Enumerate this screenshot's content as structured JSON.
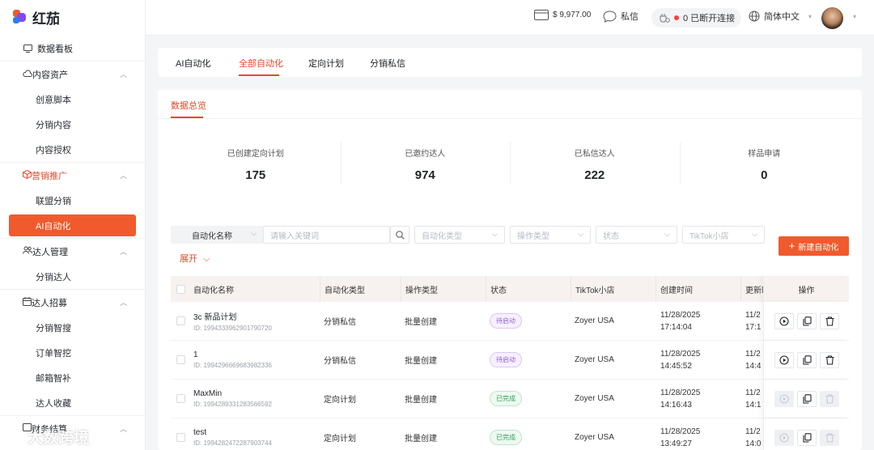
{
  "app": {
    "name": "红茄"
  },
  "sidebar": {
    "dashboard": "数据看板",
    "groups": [
      {
        "label": "内容资产",
        "items": [
          "创意脚本",
          "分销内容",
          "内容授权"
        ]
      },
      {
        "label": "营销推广",
        "items": [
          "联盟分销",
          "AI自动化"
        ]
      },
      {
        "label": "达人管理",
        "items": [
          "分销达人"
        ]
      },
      {
        "label": "达人招募",
        "items": [
          "分销智搜",
          "订单智挖",
          "邮箱智补",
          "达人收藏"
        ]
      },
      {
        "label": "财务结算",
        "items": []
      }
    ]
  },
  "header": {
    "balance": "$ 9,977.00",
    "messages": "私信",
    "connection": "0 已断开连接",
    "language": "简体中文"
  },
  "tabs": [
    "AI自动化",
    "全部自动化",
    "定向计划",
    "分销私信"
  ],
  "subtab": "数据总览",
  "stats": [
    {
      "label": "已创建定向计划",
      "value": "175"
    },
    {
      "label": "已邀约达人",
      "value": "974"
    },
    {
      "label": "已私信达人",
      "value": "222"
    },
    {
      "label": "样品申请",
      "value": "0"
    }
  ],
  "filters": {
    "field": "自动化名称",
    "keyword_placeholder": "请输入关键词",
    "type": "自动化类型",
    "op_type": "操作类型",
    "status": "状态",
    "shop": "TikTok小店",
    "expand": "展开",
    "new_button": "新建自动化"
  },
  "table": {
    "headers": [
      "自动化名称",
      "自动化类型",
      "操作类型",
      "状态",
      "TikTok小店",
      "创建时间",
      "更新时",
      "操作"
    ],
    "rows": [
      {
        "name": "3c 新品计划",
        "id": "ID: 1994333962901790720",
        "type": "分销私信",
        "op": "批量创建",
        "status": "待启动",
        "shop": "Zoyer USA",
        "date": "11/28/2025",
        "time": "17:14:04",
        "upd_date": "11/2",
        "upd_time": "17:1"
      },
      {
        "name": "1",
        "id": "ID: 1994296669683982336",
        "type": "分销私信",
        "op": "批量创建",
        "status": "待启动",
        "shop": "Zoyer USA",
        "date": "11/28/2025",
        "time": "14:45:52",
        "upd_date": "11/2",
        "upd_time": "14:4"
      },
      {
        "name": "MaxMin",
        "id": "ID: 1994289331283566592",
        "type": "定向计划",
        "op": "批量创建",
        "status": "已完成",
        "shop": "Zoyer USA",
        "date": "11/28/2025",
        "time": "14:16:43",
        "upd_date": "11/2",
        "upd_time": "14:1"
      },
      {
        "name": "test",
        "id": "ID: 1994282472287903744",
        "type": "定向计划",
        "op": "批量创建",
        "status": "已完成",
        "shop": "Zoyer USA",
        "date": "11/28/2025",
        "time": "13:49:27",
        "upd_date": "11/2",
        "upd_time": "14:0"
      }
    ]
  },
  "watermark": "大数跨境"
}
